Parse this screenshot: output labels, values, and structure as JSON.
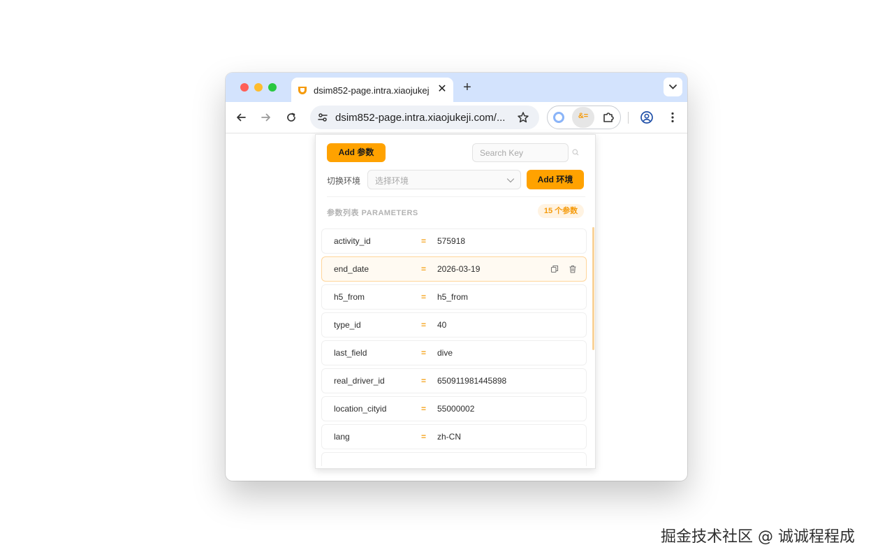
{
  "browser": {
    "tab": {
      "title": "dsim852-page.intra.xiaojukeji.com",
      "favicon": "didi-logo-icon",
      "close_glyph": "✕"
    },
    "new_tab_glyph": "+",
    "address_bar": {
      "url": "dsim852-page.intra.xiaojukeji.com/..."
    },
    "extension_active_glyph": "&="
  },
  "popup": {
    "add_param_label": "Add 参数",
    "search": {
      "placeholder": "Search Key",
      "value": ""
    },
    "env": {
      "label": "切换环境",
      "select_placeholder": "选择环境",
      "add_label": "Add 环境"
    },
    "section_title": "参数列表 PARAMETERS",
    "count_badge": "15 个参数",
    "params": [
      {
        "key": "activity_id",
        "value": "575918"
      },
      {
        "key": "end_date",
        "value": "2026-03-19"
      },
      {
        "key": "h5_from",
        "value": "h5_from"
      },
      {
        "key": "type_id",
        "value": "40"
      },
      {
        "key": "last_field",
        "value": "dive"
      },
      {
        "key": "real_driver_id",
        "value": "650911981445898"
      },
      {
        "key": "location_cityid",
        "value": "55000002"
      },
      {
        "key": "lang",
        "value": "zh-CN"
      }
    ],
    "equals": "=",
    "accent_color": "#ffa200"
  },
  "watermark": "掘金技术社区 @ 诚诚程程成"
}
